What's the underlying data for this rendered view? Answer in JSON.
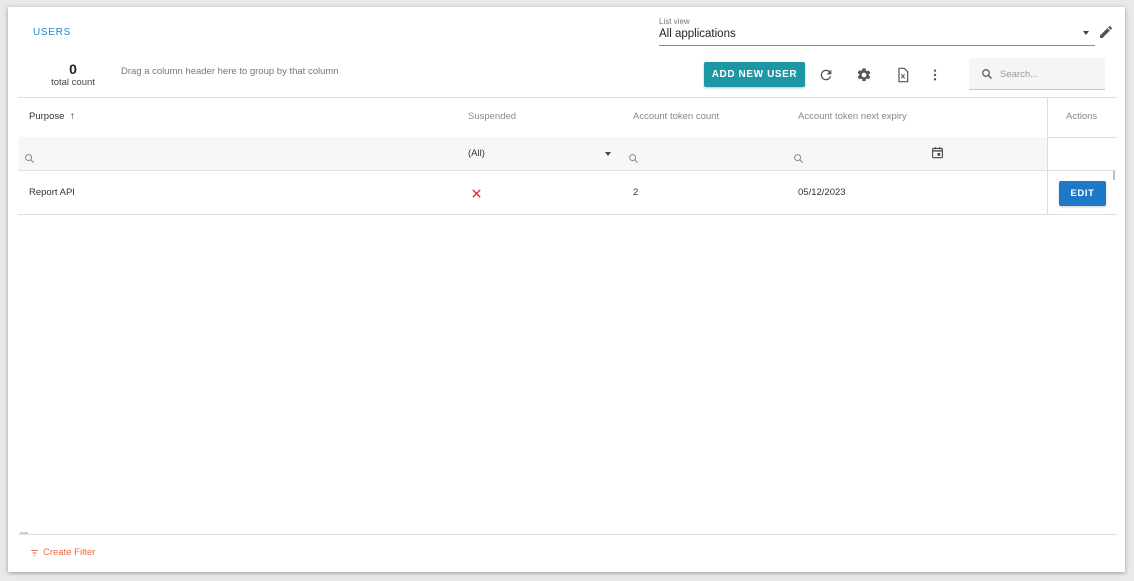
{
  "header": {
    "tab_label": "USERS",
    "list_view_label": "List view",
    "list_view_value": "All applications"
  },
  "toolbar": {
    "total_count": "0",
    "total_count_label": "total count",
    "group_hint": "Drag a column header here to group by that column",
    "add_button": "ADD NEW USER",
    "icons": [
      "refresh-icon",
      "gear-icon",
      "excel-export-icon",
      "more-vert-icon"
    ],
    "search_placeholder": "Search..."
  },
  "grid": {
    "columns": [
      {
        "label": "Purpose",
        "sort": "ascending"
      },
      {
        "label": "Suspended"
      },
      {
        "label": "Account token count"
      },
      {
        "label": "Account token next expiry"
      },
      {
        "label": "Actions"
      }
    ],
    "filters": {
      "suspended": "(All)"
    },
    "rows": [
      {
        "purpose": "Report API",
        "suspended": false,
        "token_count": "2",
        "next_expiry": "05/12/2023",
        "action": "EDIT"
      }
    ]
  },
  "footer": {
    "create_filter": "Create Filter"
  },
  "colors": {
    "tab": "#1a8bd0",
    "add_button": "#1c97a3",
    "edit_button": "#1e78c8",
    "suspended_x": "#d32f2f",
    "create_filter": "#f0663b"
  }
}
